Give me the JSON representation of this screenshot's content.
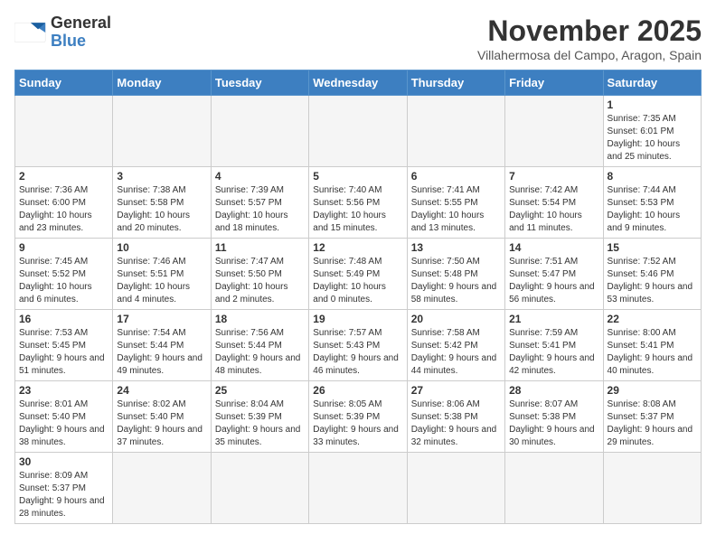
{
  "header": {
    "logo_general": "General",
    "logo_blue": "Blue",
    "month_title": "November 2025",
    "location": "Villahermosa del Campo, Aragon, Spain"
  },
  "days_of_week": [
    "Sunday",
    "Monday",
    "Tuesday",
    "Wednesday",
    "Thursday",
    "Friday",
    "Saturday"
  ],
  "weeks": [
    [
      {
        "day": "",
        "info": ""
      },
      {
        "day": "",
        "info": ""
      },
      {
        "day": "",
        "info": ""
      },
      {
        "day": "",
        "info": ""
      },
      {
        "day": "",
        "info": ""
      },
      {
        "day": "",
        "info": ""
      },
      {
        "day": "1",
        "info": "Sunrise: 7:35 AM\nSunset: 6:01 PM\nDaylight: 10 hours and 25 minutes."
      }
    ],
    [
      {
        "day": "2",
        "info": "Sunrise: 7:36 AM\nSunset: 6:00 PM\nDaylight: 10 hours and 23 minutes."
      },
      {
        "day": "3",
        "info": "Sunrise: 7:38 AM\nSunset: 5:58 PM\nDaylight: 10 hours and 20 minutes."
      },
      {
        "day": "4",
        "info": "Sunrise: 7:39 AM\nSunset: 5:57 PM\nDaylight: 10 hours and 18 minutes."
      },
      {
        "day": "5",
        "info": "Sunrise: 7:40 AM\nSunset: 5:56 PM\nDaylight: 10 hours and 15 minutes."
      },
      {
        "day": "6",
        "info": "Sunrise: 7:41 AM\nSunset: 5:55 PM\nDaylight: 10 hours and 13 minutes."
      },
      {
        "day": "7",
        "info": "Sunrise: 7:42 AM\nSunset: 5:54 PM\nDaylight: 10 hours and 11 minutes."
      },
      {
        "day": "8",
        "info": "Sunrise: 7:44 AM\nSunset: 5:53 PM\nDaylight: 10 hours and 9 minutes."
      }
    ],
    [
      {
        "day": "9",
        "info": "Sunrise: 7:45 AM\nSunset: 5:52 PM\nDaylight: 10 hours and 6 minutes."
      },
      {
        "day": "10",
        "info": "Sunrise: 7:46 AM\nSunset: 5:51 PM\nDaylight: 10 hours and 4 minutes."
      },
      {
        "day": "11",
        "info": "Sunrise: 7:47 AM\nSunset: 5:50 PM\nDaylight: 10 hours and 2 minutes."
      },
      {
        "day": "12",
        "info": "Sunrise: 7:48 AM\nSunset: 5:49 PM\nDaylight: 10 hours and 0 minutes."
      },
      {
        "day": "13",
        "info": "Sunrise: 7:50 AM\nSunset: 5:48 PM\nDaylight: 9 hours and 58 minutes."
      },
      {
        "day": "14",
        "info": "Sunrise: 7:51 AM\nSunset: 5:47 PM\nDaylight: 9 hours and 56 minutes."
      },
      {
        "day": "15",
        "info": "Sunrise: 7:52 AM\nSunset: 5:46 PM\nDaylight: 9 hours and 53 minutes."
      }
    ],
    [
      {
        "day": "16",
        "info": "Sunrise: 7:53 AM\nSunset: 5:45 PM\nDaylight: 9 hours and 51 minutes."
      },
      {
        "day": "17",
        "info": "Sunrise: 7:54 AM\nSunset: 5:44 PM\nDaylight: 9 hours and 49 minutes."
      },
      {
        "day": "18",
        "info": "Sunrise: 7:56 AM\nSunset: 5:44 PM\nDaylight: 9 hours and 48 minutes."
      },
      {
        "day": "19",
        "info": "Sunrise: 7:57 AM\nSunset: 5:43 PM\nDaylight: 9 hours and 46 minutes."
      },
      {
        "day": "20",
        "info": "Sunrise: 7:58 AM\nSunset: 5:42 PM\nDaylight: 9 hours and 44 minutes."
      },
      {
        "day": "21",
        "info": "Sunrise: 7:59 AM\nSunset: 5:41 PM\nDaylight: 9 hours and 42 minutes."
      },
      {
        "day": "22",
        "info": "Sunrise: 8:00 AM\nSunset: 5:41 PM\nDaylight: 9 hours and 40 minutes."
      }
    ],
    [
      {
        "day": "23",
        "info": "Sunrise: 8:01 AM\nSunset: 5:40 PM\nDaylight: 9 hours and 38 minutes."
      },
      {
        "day": "24",
        "info": "Sunrise: 8:02 AM\nSunset: 5:40 PM\nDaylight: 9 hours and 37 minutes."
      },
      {
        "day": "25",
        "info": "Sunrise: 8:04 AM\nSunset: 5:39 PM\nDaylight: 9 hours and 35 minutes."
      },
      {
        "day": "26",
        "info": "Sunrise: 8:05 AM\nSunset: 5:39 PM\nDaylight: 9 hours and 33 minutes."
      },
      {
        "day": "27",
        "info": "Sunrise: 8:06 AM\nSunset: 5:38 PM\nDaylight: 9 hours and 32 minutes."
      },
      {
        "day": "28",
        "info": "Sunrise: 8:07 AM\nSunset: 5:38 PM\nDaylight: 9 hours and 30 minutes."
      },
      {
        "day": "29",
        "info": "Sunrise: 8:08 AM\nSunset: 5:37 PM\nDaylight: 9 hours and 29 minutes."
      }
    ],
    [
      {
        "day": "30",
        "info": "Sunrise: 8:09 AM\nSunset: 5:37 PM\nDaylight: 9 hours and 28 minutes."
      },
      {
        "day": "",
        "info": ""
      },
      {
        "day": "",
        "info": ""
      },
      {
        "day": "",
        "info": ""
      },
      {
        "day": "",
        "info": ""
      },
      {
        "day": "",
        "info": ""
      },
      {
        "day": "",
        "info": ""
      }
    ]
  ]
}
